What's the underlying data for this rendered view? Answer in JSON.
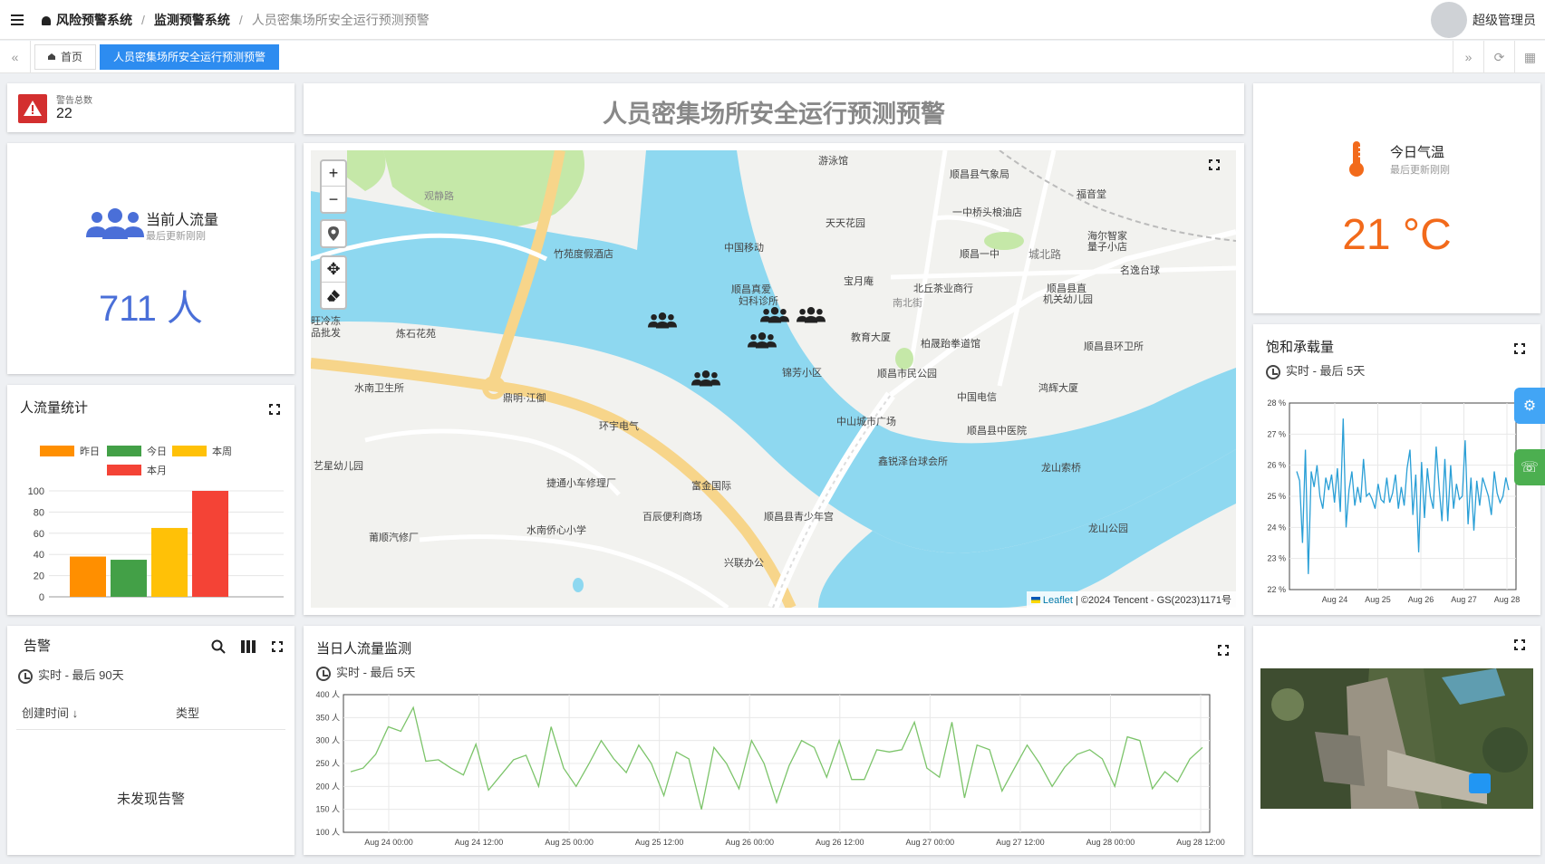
{
  "header": {
    "breadcrumbs": [
      "风险预警系统",
      "监测预警系统",
      "人员密集场所安全运行预测预警"
    ],
    "user_name": "超级管理员"
  },
  "tabs": [
    {
      "label": "首页",
      "active": false
    },
    {
      "label": "人员密集场所安全运行预测预警",
      "active": true
    }
  ],
  "page_title": "人员密集场所安全运行预测预警",
  "alarm_total": {
    "label": "警告总数",
    "value": "22"
  },
  "current_flow": {
    "title": "当前人流量",
    "updated": "最后更新刚刚",
    "value": "711 人"
  },
  "weather": {
    "title": "今日气温",
    "updated": "最后更新刚刚",
    "value": "21 °C"
  },
  "flow_stats": {
    "title": "人流量统计"
  },
  "alarms": {
    "title": "告警",
    "range": "实时 - 最后 90天",
    "col_time": "创建时间",
    "col_type": "类型",
    "empty": "未发现告警"
  },
  "daily_monitor": {
    "title": "当日人流量监测",
    "range": "实时 - 最后 5天"
  },
  "saturation": {
    "title": "饱和承载量",
    "range": "实时 - 最后 5天"
  },
  "map": {
    "attribution_leaflet": "Leaflet",
    "attribution_rest": "| ©2024 Tencent - GS(2023)1171号",
    "labels": [
      {
        "t": "游泳馆"
      },
      {
        "t": "顺昌县气象局"
      },
      {
        "t": "福音堂"
      },
      {
        "t": "观静路"
      },
      {
        "t": "一中桥头桹油店"
      },
      {
        "t": "天天花园"
      },
      {
        "t": "海尔智家"
      },
      {
        "t": "量子小店"
      },
      {
        "t": "竹苑度假酒店"
      },
      {
        "t": "中国移动"
      },
      {
        "t": "顺昌一中"
      },
      {
        "t": "城北路"
      },
      {
        "t": "名逸台球"
      },
      {
        "t": "宝月庵"
      },
      {
        "t": "北丘茶业商行"
      },
      {
        "t": "顺昌县直"
      },
      {
        "t": "机关幼儿园"
      },
      {
        "t": "顺昌真爱"
      },
      {
        "t": "妇科诊所"
      },
      {
        "t": "旺冷冻"
      },
      {
        "t": "品批发"
      },
      {
        "t": "炼石花苑"
      },
      {
        "t": "南北街"
      },
      {
        "t": "柏晟跆拳道馆"
      },
      {
        "t": "教育大厦"
      },
      {
        "t": "顺昌县环卫所"
      },
      {
        "t": "锦芳小区"
      },
      {
        "t": "顺昌市民公园"
      },
      {
        "t": "水南卫生所"
      },
      {
        "t": "鼎明·江御"
      },
      {
        "t": "中国电信"
      },
      {
        "t": "鸿辉大厦"
      },
      {
        "t": "环宇电气"
      },
      {
        "t": "中山城市广场"
      },
      {
        "t": "顺昌县中医院"
      },
      {
        "t": "艺星幼儿园"
      },
      {
        "t": "鑫锐泽台球会所"
      },
      {
        "t": "龙山索桥"
      },
      {
        "t": "捷通小车修理厂"
      },
      {
        "t": "富金国际"
      },
      {
        "t": "百辰便利商场"
      },
      {
        "t": "顺昌县青少年宫"
      },
      {
        "t": "莆顺汽修厂"
      },
      {
        "t": "水南侨心小学"
      },
      {
        "t": "龙山公园"
      },
      {
        "t": "兴联办公"
      }
    ]
  },
  "chart_data": [
    {
      "type": "bar",
      "title": "人流量统计",
      "categories": [
        "昨日",
        "今日",
        "本周",
        "本月"
      ],
      "values": [
        38,
        35,
        65,
        100
      ],
      "colors": [
        "#ff8f00",
        "#43a047",
        "#ffc107",
        "#f44336"
      ],
      "legend": "top",
      "ylim": [
        0,
        100
      ],
      "yticks": [
        0,
        20,
        40,
        60,
        80,
        100
      ]
    },
    {
      "type": "line",
      "title": "当日人流量监测",
      "color": "#7cc46a",
      "ylim": [
        100,
        400
      ],
      "yticks": [
        "100 人",
        "150 人",
        "200 人",
        "250 人",
        "300 人",
        "350 人",
        "400 人"
      ],
      "xticks": [
        "Aug 24 00:00",
        "Aug 24 12:00",
        "Aug 25 00:00",
        "Aug 25 12:00",
        "Aug 26 00:00",
        "Aug 26 12:00",
        "Aug 27 00:00",
        "Aug 27 12:00",
        "Aug 28 00:00",
        "Aug 28 12:00"
      ],
      "values": [
        232,
        240,
        270,
        330,
        320,
        372,
        255,
        258,
        240,
        225,
        292,
        192,
        225,
        258,
        268,
        200,
        330,
        240,
        200,
        248,
        300,
        260,
        230,
        290,
        250,
        180,
        275,
        260,
        150,
        285,
        250,
        195,
        300,
        250,
        165,
        245,
        300,
        285,
        220,
        300,
        215,
        215,
        280,
        275,
        280,
        340,
        240,
        220,
        340,
        175,
        290,
        280,
        190,
        240,
        290,
        250,
        200,
        242,
        270,
        280,
        260,
        200,
        308,
        300,
        195,
        232,
        210,
        260,
        285
      ]
    },
    {
      "type": "line",
      "title": "饱和承载量",
      "color": "#2a9fd6",
      "ylim": [
        22,
        28
      ],
      "yticks": [
        "22 %",
        "23 %",
        "24 %",
        "25 %",
        "26 %",
        "27 %",
        "28 %"
      ],
      "xticks": [
        "Aug 24",
        "Aug 25",
        "Aug 26",
        "Aug 27",
        "Aug 28"
      ],
      "values": [
        25.8,
        25.5,
        23.5,
        26.5,
        22.5,
        25.8,
        25.3,
        26.0,
        25.0,
        24.6,
        25.6,
        25.2,
        25.7,
        24.8,
        25.9,
        24.5,
        27.5,
        24.0,
        25.2,
        25.8,
        24.7,
        25.3,
        24.8,
        26.2,
        25.0,
        25.1,
        24.9,
        24.6,
        25.4,
        24.9,
        24.8,
        25.6,
        24.8,
        25.1,
        25.7,
        24.6,
        25.3,
        24.7,
        25.9,
        26.5,
        24.4,
        25.7,
        23.2,
        26.1,
        24.3,
        25.9,
        25.0,
        24.6,
        26.6,
        25.3,
        24.2,
        26.2,
        24.2,
        26.0,
        24.6,
        25.4,
        24.9,
        25.0,
        26.8,
        24.1,
        25.6,
        23.9,
        25.5,
        24.7,
        25.6,
        25.3,
        25.0,
        24.4,
        25.8,
        25.1,
        24.8,
        25.0,
        25.6,
        25.2
      ]
    }
  ]
}
